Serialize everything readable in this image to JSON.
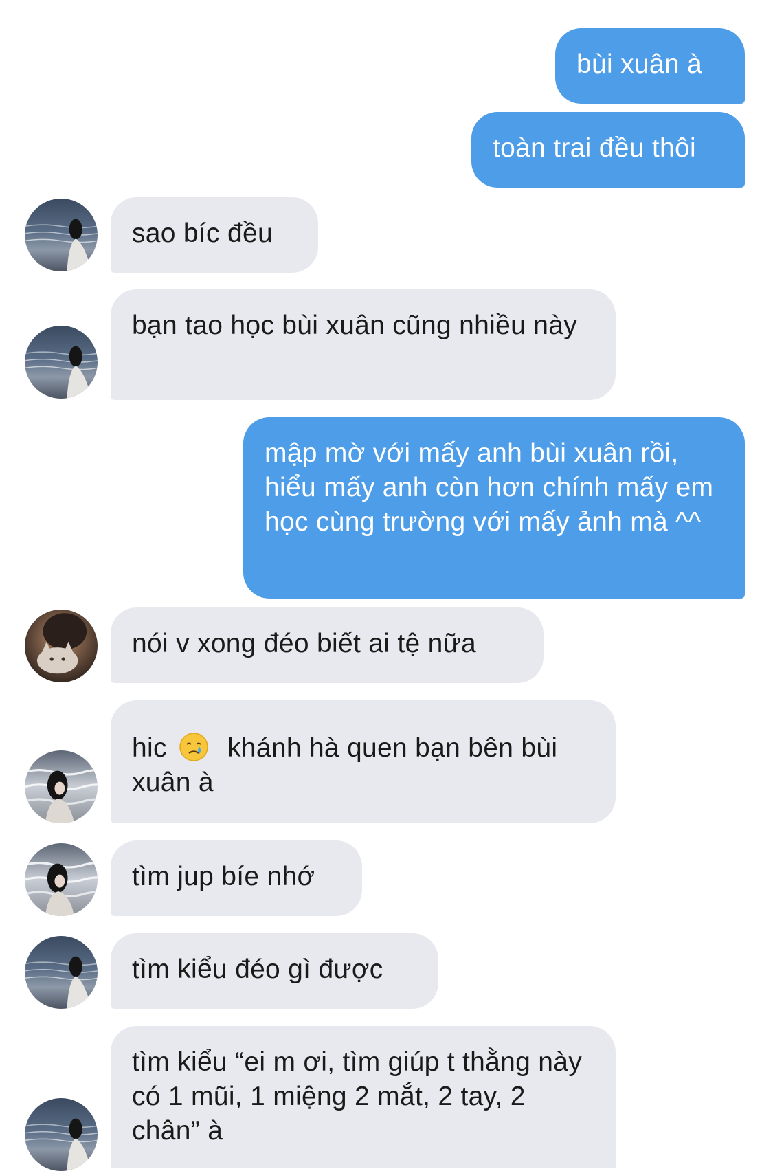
{
  "conversation": {
    "messages": [
      {
        "side": "out",
        "text": "bùi xuân à"
      },
      {
        "side": "out",
        "text": "toàn trai đều thôi"
      },
      {
        "side": "in",
        "text": "sao bíc đều",
        "avatar": "sea-girl-avatar"
      },
      {
        "side": "in",
        "text": "bạn tao học bùi xuân cũng nhiều này",
        "avatar": "sea-girl-avatar"
      },
      {
        "side": "out",
        "text": "mập mờ với mấy anh bùi xuân rồi, hiểu mấy anh còn hơn chính mấy em học cùng trường với mấy ảnh mà ^^"
      },
      {
        "side": "in",
        "text": "nói v xong đéo biết ai tệ nữa",
        "avatar": "cat-girl-avatar"
      },
      {
        "side": "in",
        "text_before": "hic",
        "emoji": "crying-face-emoji",
        "text_after": "khánh hà quen bạn bên bùi xuân à",
        "avatar": "waves-girl-avatar"
      },
      {
        "side": "in",
        "text": "tìm jup bíe nhớ",
        "avatar": "waves-girl-avatar"
      },
      {
        "side": "in",
        "text": "tìm kiểu đéo gì được",
        "avatar": "sea-girl-avatar"
      },
      {
        "side": "in",
        "text": "tìm kiểu “ei m ơi, tìm giúp t thằng này có 1 mũi, 1 miệng 2 mắt, 2 tay, 2 chân” à",
        "avatar": "sea-girl-avatar"
      }
    ]
  },
  "colors": {
    "outgoing_bubble": "#4e9de8",
    "incoming_bubble": "#e8e9ee",
    "background": "#ffffff"
  }
}
